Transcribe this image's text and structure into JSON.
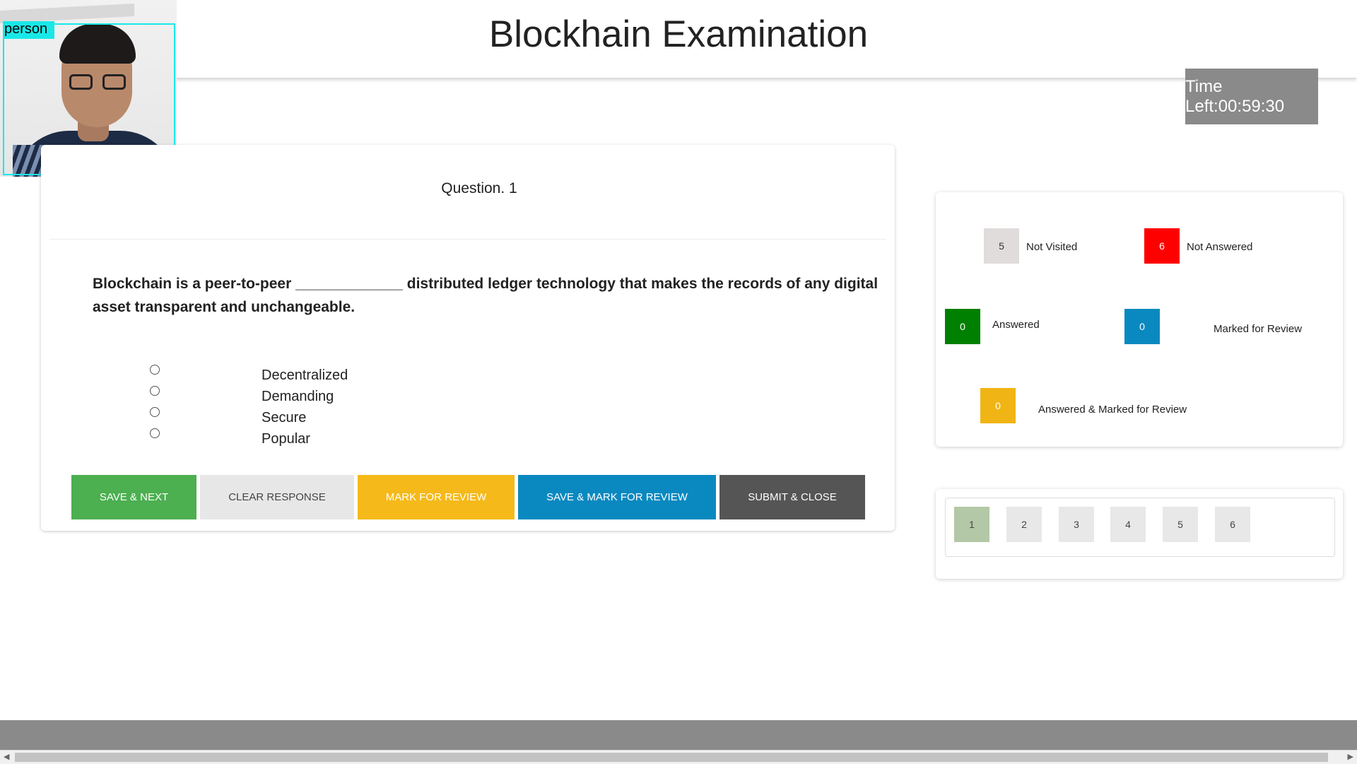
{
  "header": {
    "title": "Blockhain Examination"
  },
  "webcam": {
    "detection_label": "person"
  },
  "timer": {
    "text": "Time Left:00:59:30"
  },
  "question": {
    "number_label": "Question. 1",
    "text": "Blockchain is a peer-to-peer _____________ distributed ledger technology that makes the records of any digital asset transparent and unchangeable.",
    "options": [
      "Decentralized",
      "Demanding",
      "Secure",
      "Popular"
    ]
  },
  "actions": {
    "save_next": "SAVE & NEXT",
    "clear_response": "CLEAR RESPONSE",
    "mark_review": "MARK FOR REVIEW",
    "save_mark_review": "SAVE & MARK FOR REVIEW",
    "submit_close": "SUBMIT & CLOSE"
  },
  "legend": {
    "not_visited": {
      "count": "5",
      "label": "Not Visited",
      "color": "#e0dcdc"
    },
    "not_answered": {
      "count": "6",
      "label": "Not Answered",
      "color": "#ff0000"
    },
    "answered": {
      "count": "0",
      "label": "Answered",
      "color": "#008000"
    },
    "marked_review": {
      "count": "0",
      "label": "Marked for Review",
      "color": "#0a89c0"
    },
    "answered_marked": {
      "count": "0",
      "label": "Answered & Marked for Review",
      "color": "#f0b414"
    }
  },
  "palette": {
    "questions": [
      "1",
      "2",
      "3",
      "4",
      "5",
      "6"
    ],
    "current": "1"
  },
  "scrollbar": {
    "left_arrow": "◀",
    "right_arrow": "▶"
  }
}
